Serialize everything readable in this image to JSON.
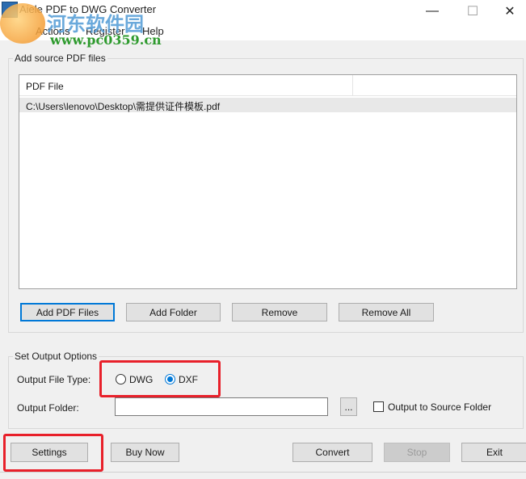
{
  "window": {
    "title": "Aiele PDF to DWG Converter",
    "min_symbol": "—",
    "max_symbol": "☐",
    "close_symbol": "✕"
  },
  "menu": {
    "items": [
      "Actions",
      "Register",
      "Help"
    ]
  },
  "watermark": {
    "text_cn": "河东软件园",
    "url": "www.pc0359.cn"
  },
  "source_group": {
    "label": "Add source PDF files",
    "column_header": "PDF File",
    "files": [
      "C:\\Users\\lenovo\\Desktop\\需提供证件模板.pdf"
    ]
  },
  "source_buttons": {
    "add_pdf_files": "Add PDF Files",
    "add_folder": "Add Folder",
    "remove": "Remove",
    "remove_all": "Remove All"
  },
  "output_group": {
    "label": "Set Output Options",
    "file_type_label": "Output File Type:",
    "options": [
      "DWG",
      "DXF"
    ],
    "selected": "DXF",
    "folder_label": "Output Folder:",
    "folder_value": "",
    "browse_label": "...",
    "output_to_source_label": "Output to Source Folder",
    "output_to_source_checked": false
  },
  "bottom_buttons": {
    "settings": "Settings",
    "buy_now": "Buy Now",
    "convert": "Convert",
    "stop": "Stop",
    "exit": "Exit"
  },
  "colors": {
    "highlight": "#e8202a",
    "accent": "#0078d7"
  }
}
